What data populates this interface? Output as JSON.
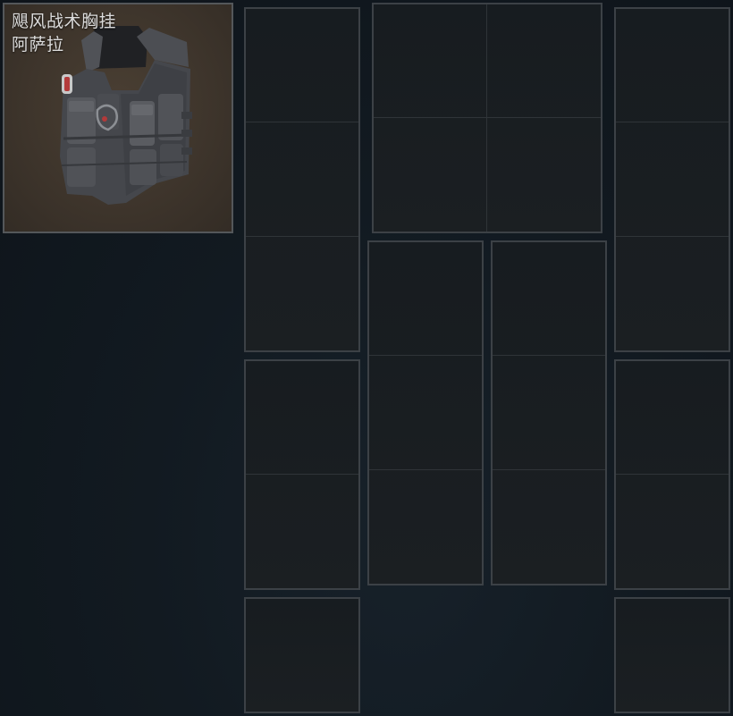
{
  "item": {
    "name_line1": "飓风战术胸挂",
    "name_line2": "阿萨拉",
    "image_icon": "tactical-vest-icon"
  },
  "rig_grid": {
    "blocks": [
      {
        "id": "left-top",
        "cols": 1,
        "rows": 3
      },
      {
        "id": "center-top",
        "cols": 2,
        "rows": 2
      },
      {
        "id": "right-top",
        "cols": 1,
        "rows": 3
      },
      {
        "id": "center-left",
        "cols": 1,
        "rows": 3
      },
      {
        "id": "center-right",
        "cols": 1,
        "rows": 3
      },
      {
        "id": "left-middle",
        "cols": 1,
        "rows": 2
      },
      {
        "id": "right-middle",
        "cols": 1,
        "rows": 2
      },
      {
        "id": "left-bottom",
        "cols": 1,
        "rows": 1
      },
      {
        "id": "right-bottom",
        "cols": 1,
        "rows": 1
      }
    ]
  },
  "colors": {
    "card_border": "#54575a",
    "slot_border": "#3c4146",
    "background": "#121a21"
  }
}
